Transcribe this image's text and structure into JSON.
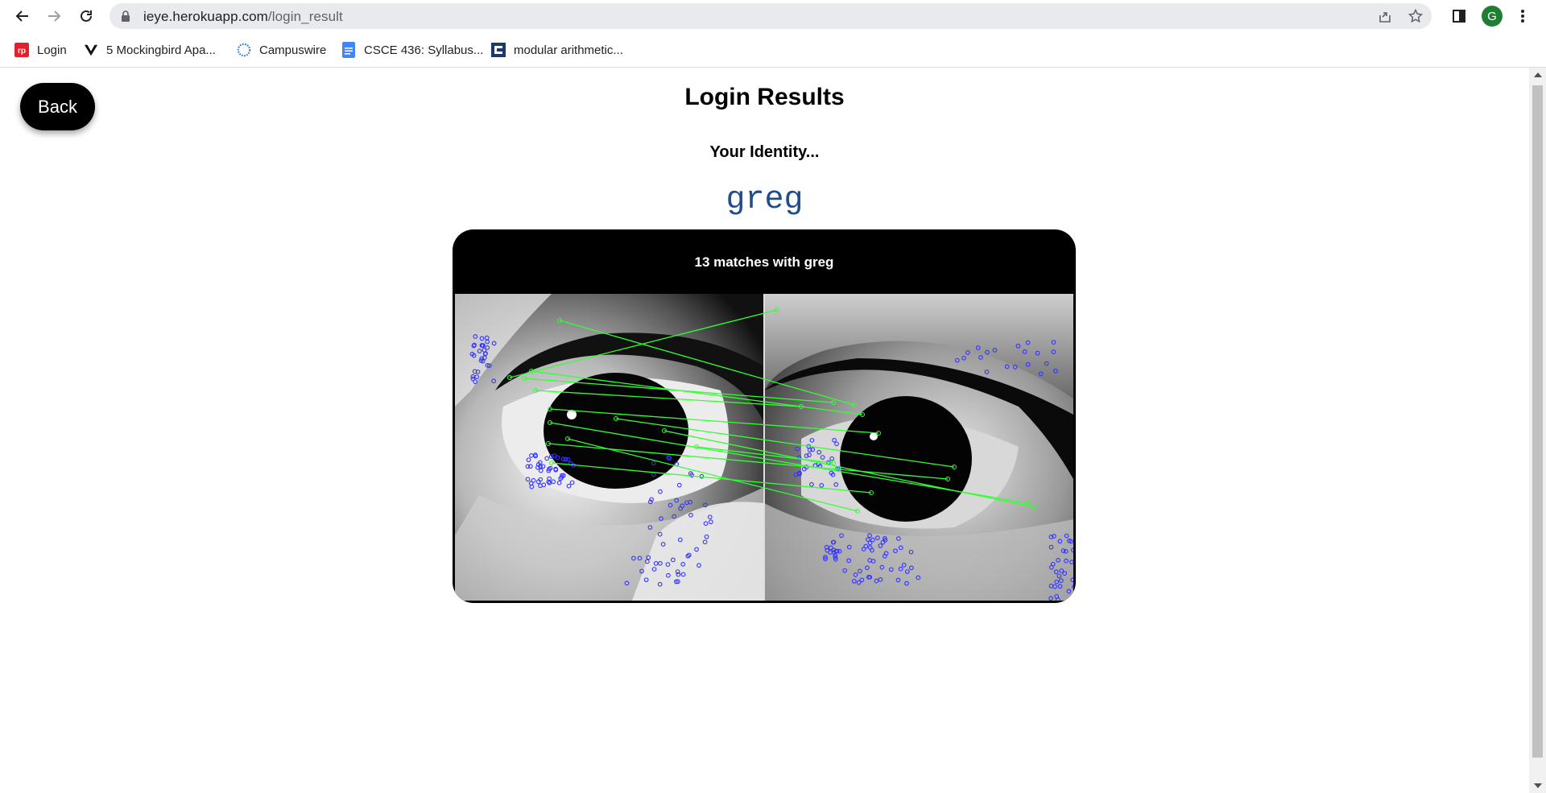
{
  "browser": {
    "url_host": "ieye.herokuapp.com",
    "url_path": "/login_result",
    "profile_initial": "G"
  },
  "bookmarks": [
    {
      "label": "Login",
      "icon": "rp-logo-icon"
    },
    {
      "label": "5 Mockingbird Apa...",
      "icon": "v-logo-icon"
    },
    {
      "label": "Campuswire",
      "icon": "campuswire-icon"
    },
    {
      "label": "CSCE 436: Syllabus...",
      "icon": "google-docs-icon"
    },
    {
      "label": "modular arithmetic...",
      "icon": "site-icon"
    }
  ],
  "page": {
    "back_label": "Back",
    "title": "Login Results",
    "subtitle": "Your Identity...",
    "identity": "greg",
    "match_caption": "13 matches with greg"
  },
  "colors": {
    "identity_text": "#1f4e8c",
    "match_line": "#33ff33",
    "keypoint": "#3333ff",
    "avatar_bg": "#1e7e34"
  }
}
